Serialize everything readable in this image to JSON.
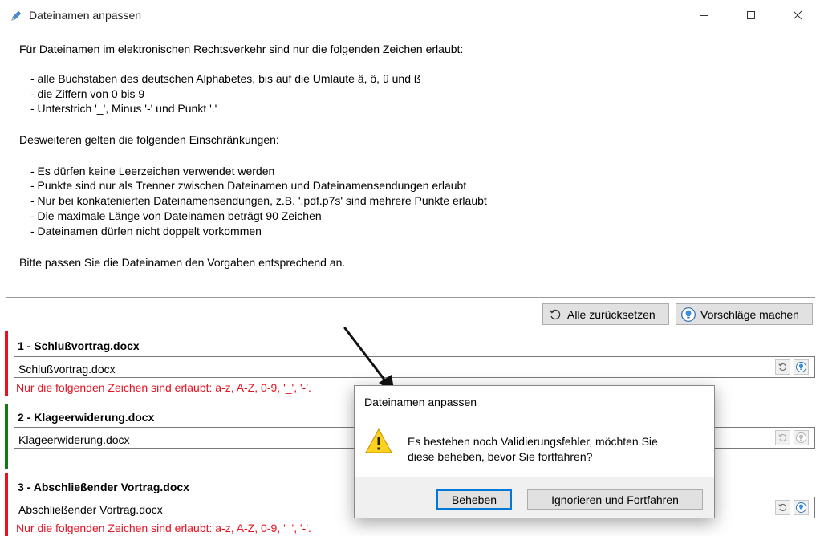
{
  "window": {
    "title": "Dateinamen anpassen",
    "icon": "pencil-icon"
  },
  "intro": {
    "line1": "Für Dateinamen im elektronischen Rechtsverkehr sind nur die folgenden Zeichen erlaubt:",
    "allowed": [
      "- alle Buchstaben des deutschen Alphabetes, bis auf die Umlaute ä, ö, ü und ß",
      "- die Ziffern von 0 bis 9",
      "- Unterstrich '_', Minus '-' und Punkt '.'"
    ],
    "line2": "Desweiteren gelten die folgenden Einschränkungen:",
    "restrictions": [
      "- Es dürfen keine Leerzeichen verwendet werden",
      "- Punkte sind nur als Trenner zwischen Dateinamen und Dateinamensendungen erlaubt",
      "- Nur bei konkatenierten Dateinamensendungen, z.B. '.pdf.p7s' sind mehrere Punkte erlaubt",
      "- Die maximale Länge von Dateinamen beträgt 90 Zeichen",
      "- Dateinamen dürfen nicht doppelt vorkommen"
    ],
    "closing": "Bitte passen Sie die Dateinamen den Vorgaben entsprechend an."
  },
  "toolbar": {
    "reset_all": "Alle zurücksetzen",
    "suggest": "Vorschläge machen"
  },
  "files": [
    {
      "title": "1  - Schlußvortrag.docx",
      "value": "Schlußvortrag.docx",
      "error": "Nur die folgenden Zeichen sind erlaubt: a-z, A-Z, 0-9, '_', '-'.",
      "status": "invalid"
    },
    {
      "title": "2  - Klageerwiderung.docx",
      "value": "Klageerwiderung.docx",
      "error": "",
      "status": "valid"
    },
    {
      "title": "3  - Abschließender Vortrag.docx",
      "value": "Abschließender Vortrag.docx",
      "error": "Nur die folgenden Zeichen sind erlaubt: a-z, A-Z, 0-9, '_', '-'.",
      "status": "invalid"
    }
  ],
  "dialog": {
    "title": "Dateinamen anpassen",
    "message_line1": "Es bestehen noch Validierungsfehler, möchten Sie",
    "message_line2": "diese beheben, bevor Sie fortfahren?",
    "fix_button": "Beheben",
    "ignore_button": "Ignorieren und Fortfahren",
    "icon": "warning-icon"
  },
  "colors": {
    "invalid": "#e81123",
    "valid": "#107c10",
    "accent": "#0078d7"
  }
}
